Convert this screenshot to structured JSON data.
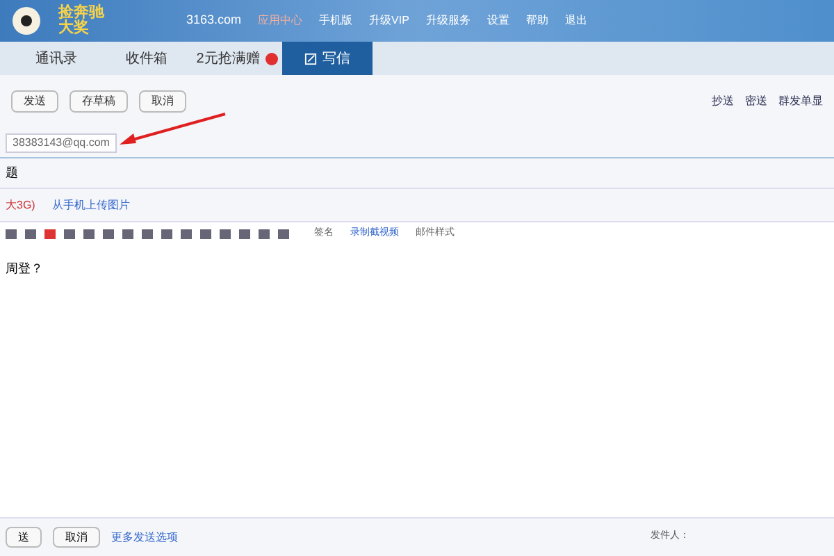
{
  "header": {
    "logo_text": "捡奔驰大奖",
    "account": "3163.com",
    "links": [
      "应用中心",
      "手机版",
      "升级VIP",
      "升级服务",
      "设置",
      "帮助",
      "退出"
    ]
  },
  "tabs": [
    {
      "label": "通讯录",
      "selected": false,
      "badge": false
    },
    {
      "label": "收件箱",
      "selected": false,
      "badge": false
    },
    {
      "label": "2元抢满赠",
      "selected": false,
      "badge": true
    },
    {
      "label": "写信",
      "selected": true,
      "badge": false
    }
  ],
  "toolbar": {
    "buttons": [
      "发送",
      "存草稿",
      "取消"
    ],
    "links": [
      "抄送",
      "密送",
      "群发单显"
    ]
  },
  "recipient": "38383143@qq.com",
  "subject_label": "题",
  "attach": {
    "label": "大3G)",
    "upload": "从手机上传图片"
  },
  "editor_tools": {
    "signature": "签名",
    "record": "录制截视频",
    "stationery": "邮件样式"
  },
  "body": "周登？",
  "bottom": {
    "buttons": [
      "送",
      "取消"
    ],
    "more": "更多发送选项",
    "sender_label": "发件人："
  }
}
